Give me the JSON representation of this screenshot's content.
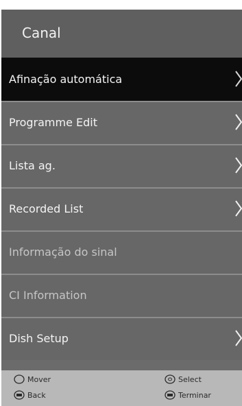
{
  "header": {
    "title": "Canal"
  },
  "menu": {
    "items": [
      {
        "label": "Afinação automática",
        "state": "selected",
        "has_arrow": true,
        "icon": "chevron-right-icon"
      },
      {
        "label": "Programme Edit",
        "state": "normal",
        "has_arrow": true,
        "icon": "chevron-right-icon"
      },
      {
        "label": "Lista ag.",
        "state": "normal",
        "has_arrow": true,
        "icon": "chevron-right-icon"
      },
      {
        "label": "Recorded List",
        "state": "normal",
        "has_arrow": true,
        "icon": "chevron-right-icon"
      },
      {
        "label": "Informação do sinal",
        "state": "disabled",
        "has_arrow": false
      },
      {
        "label": "CI Information",
        "state": "disabled",
        "has_arrow": false
      },
      {
        "label": "Dish Setup",
        "state": "normal",
        "has_arrow": true,
        "icon": "chevron-right-icon"
      }
    ]
  },
  "footer": {
    "move_label": "Mover",
    "back_label": "Back",
    "select_label": "Select",
    "exit_label": "Terminar",
    "move_icon": "dpad-icon",
    "back_icon": "back-key-icon",
    "select_icon": "ok-key-icon",
    "exit_icon": "exit-key-icon"
  },
  "colors": {
    "panel": "#6b6b6b",
    "selected_row": "#0c0c0c",
    "footer": "#b8b8b8",
    "text": "#f4f4f4",
    "disabled_text": "#c6c6c6"
  }
}
